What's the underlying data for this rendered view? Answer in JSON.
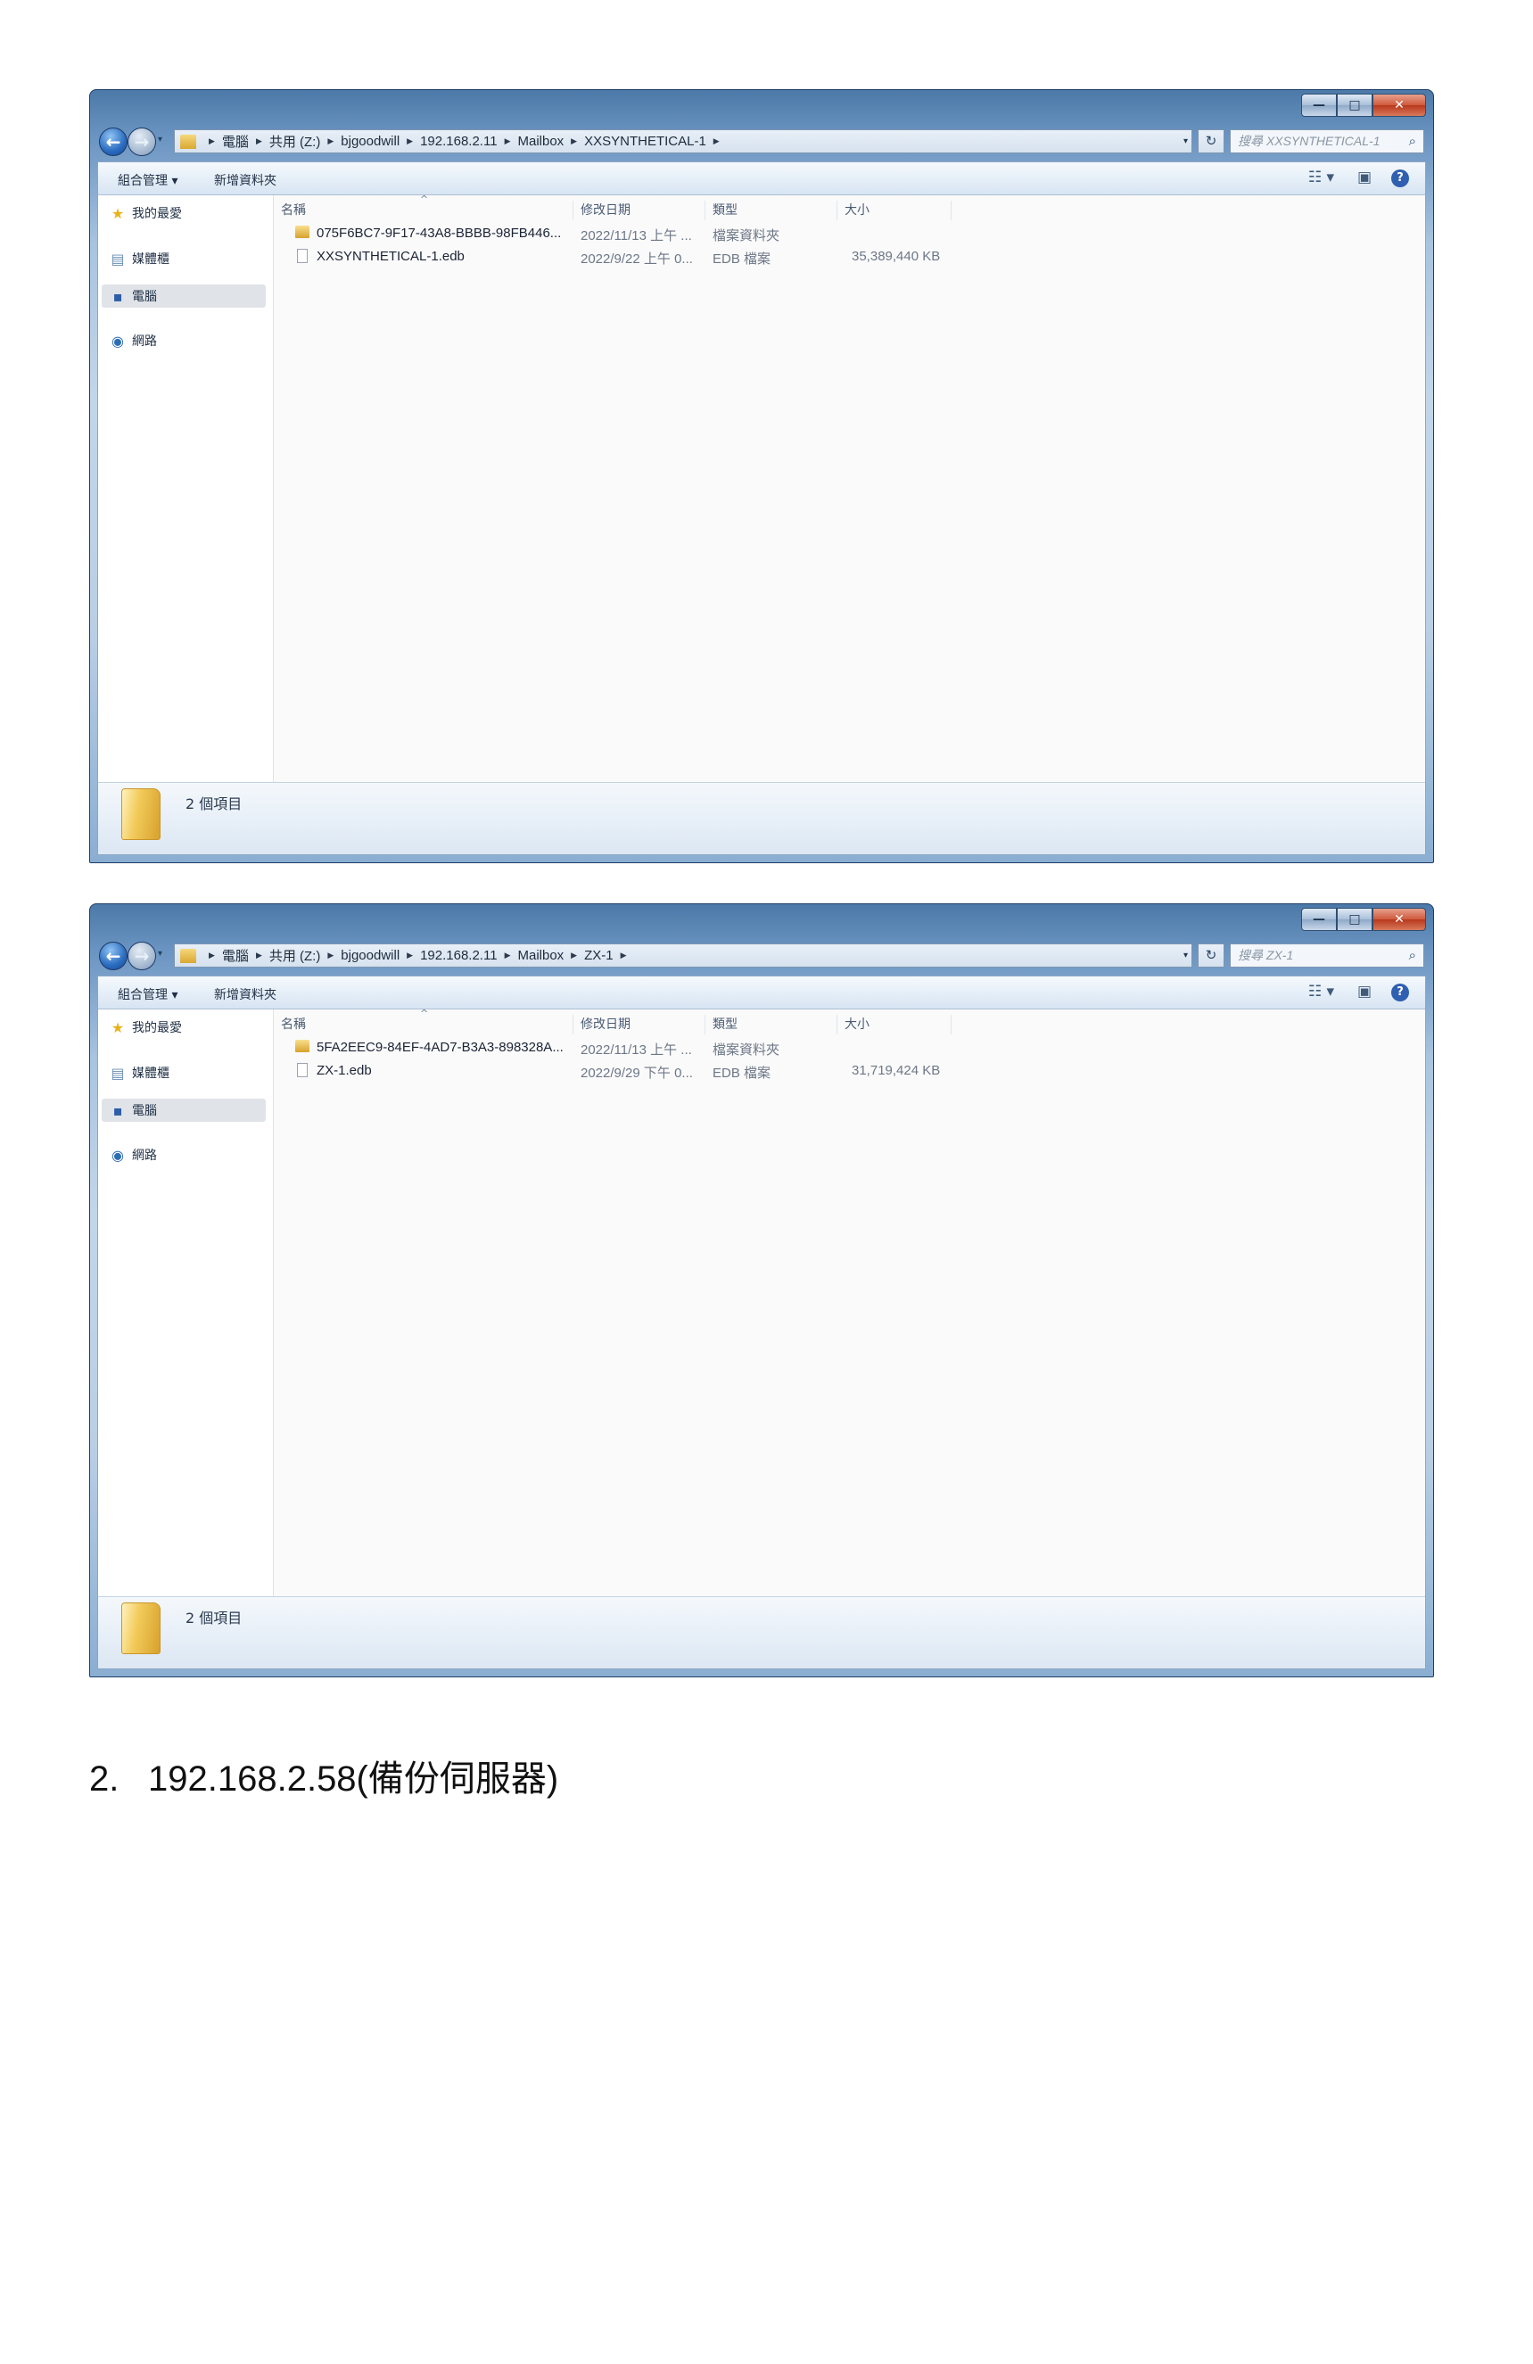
{
  "window_controls": {
    "minimize": "—",
    "maximize": "□",
    "close": "✕"
  },
  "command_bar": {
    "organize": "組合管理 ▾",
    "new_folder": "新增資料夾"
  },
  "nav_pane": {
    "favorites": "我的最愛",
    "libraries": "媒體櫃",
    "computer": "電腦",
    "network": "網路"
  },
  "columns": {
    "name": "名稱",
    "modified": "修改日期",
    "type": "類型",
    "size": "大小"
  },
  "icons": [
    "back-arrow-icon",
    "forward-arrow-icon",
    "folder-icon",
    "refresh-icon",
    "search-icon",
    "star-icon",
    "library-icon",
    "computer-icon",
    "network-icon",
    "view-icon",
    "preview-pane-icon",
    "help-icon",
    "file-icon"
  ],
  "windows": [
    {
      "breadcrumb": [
        "電腦",
        "共用 (Z:)",
        "bjgoodwill",
        "192.168.2.11",
        "Mailbox",
        "XXSYNTHETICAL-1"
      ],
      "search_placeholder": "搜尋 XXSYNTHETICAL-1",
      "rows": [
        {
          "name": "075F6BC7-9F17-43A8-BBBB-98FB446...",
          "modified": "2022/11/13 上午 ...",
          "type": "檔案資料夾",
          "size": "",
          "kind": "folder"
        },
        {
          "name": "XXSYNTHETICAL-1.edb",
          "modified": "2022/9/22 上午 0...",
          "type": "EDB 檔案",
          "size": "35,389,440 KB",
          "kind": "file"
        }
      ],
      "item_count": "2 個項目"
    },
    {
      "breadcrumb": [
        "電腦",
        "共用 (Z:)",
        "bjgoodwill",
        "192.168.2.11",
        "Mailbox",
        "ZX-1"
      ],
      "search_placeholder": "搜尋 ZX-1",
      "rows": [
        {
          "name": "5FA2EEC9-84EF-4AD7-B3A3-898328A...",
          "modified": "2022/11/13 上午 ...",
          "type": "檔案資料夾",
          "size": "",
          "kind": "folder"
        },
        {
          "name": "ZX-1.edb",
          "modified": "2022/9/29 下午 0...",
          "type": "EDB 檔案",
          "size": "31,719,424 KB",
          "kind": "file"
        }
      ],
      "item_count": "2 個項目"
    }
  ],
  "caption": {
    "number": "2.",
    "text": "192.168.2.58(備份伺服器)"
  }
}
